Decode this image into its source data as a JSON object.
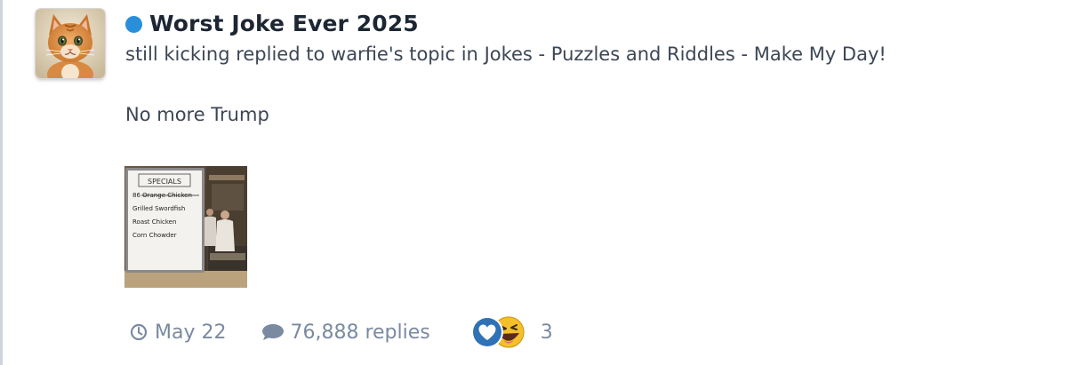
{
  "topic": {
    "title": "Worst Joke Ever 2025",
    "status_color": "#2a8fdb",
    "activity": {
      "user": "still kicking",
      "action": "replied to",
      "topic_owner": "warfie's topic",
      "preposition": "in",
      "forum_path": "Jokes - Puzzles and Riddles - Make My Day!"
    },
    "snippet": "No more Trump"
  },
  "attachment": {
    "board_heading": "SPECIALS",
    "board_items": [
      "86 Orange Chicken",
      "Grilled Swordfish",
      "Roast Chicken",
      "Corn Chowder"
    ]
  },
  "meta": {
    "date": "May 22",
    "replies": "76,888 replies",
    "reaction_count": "3",
    "icons": {
      "date": "clock-icon",
      "replies": "comment-icon",
      "reactions": [
        "heart-reaction-icon",
        "laugh-reaction-icon"
      ]
    },
    "colors": {
      "meta_text": "#7a8aa0",
      "heart_bg": "#2f72b5",
      "laugh_bg": "#f3c02b"
    }
  }
}
